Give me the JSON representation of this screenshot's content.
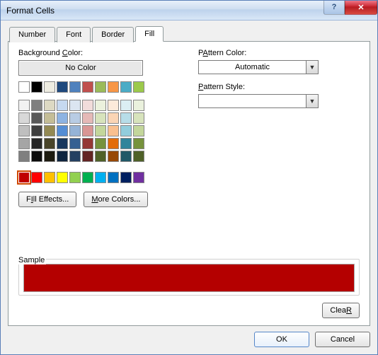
{
  "window": {
    "title": "Format Cells",
    "help_icon": "?",
    "close_icon": "✕"
  },
  "tabs": [
    {
      "label": "Number",
      "active": false
    },
    {
      "label": "Font",
      "active": false
    },
    {
      "label": "Border",
      "active": false
    },
    {
      "label": "Fill",
      "active": true
    }
  ],
  "fill": {
    "bg_color_label_pre": "Background ",
    "bg_color_label_u": "C",
    "bg_color_label_post": "olor:",
    "no_color_label": "No Color",
    "fill_effects_label": "Fill Effects...",
    "fill_effects_u": "I",
    "more_colors_label": "More Colors...",
    "more_colors_u": "M",
    "pattern_color_label": "Pattern Color:",
    "pattern_color_u": "A",
    "pattern_color_value": "Automatic",
    "pattern_style_label": "Pattern Style:",
    "pattern_style_u": "P",
    "pattern_style_value": "",
    "theme_colors_row1": [
      "#ffffff",
      "#000000",
      "#eeece1",
      "#1f497d",
      "#4f81bd",
      "#c0504d",
      "#9bbb59",
      "#f79646",
      "#4bacc6",
      "#9cc94b"
    ],
    "theme_colors_rows": [
      [
        "#f2f2f2",
        "#7f7f7f",
        "#ddd9c3",
        "#c6d9f0",
        "#dbe5f1",
        "#f2dcdb",
        "#ebf1dd",
        "#fdeada",
        "#dbeef3",
        "#eaf1dd"
      ],
      [
        "#d8d8d8",
        "#595959",
        "#c4bd97",
        "#8db3e2",
        "#b8cce4",
        "#e5b9b7",
        "#d7e3bc",
        "#fbd5b5",
        "#b7dde8",
        "#d7e3bc"
      ],
      [
        "#bfbfbf",
        "#3f3f3f",
        "#938953",
        "#548dd4",
        "#95b3d7",
        "#d99694",
        "#c3d69b",
        "#fac08f",
        "#92cddc",
        "#c3d69b"
      ],
      [
        "#a5a5a5",
        "#262626",
        "#494429",
        "#17365d",
        "#366092",
        "#953734",
        "#76923c",
        "#e36c09",
        "#31859b",
        "#76923c"
      ],
      [
        "#7f7f7f",
        "#0c0c0c",
        "#1d1b10",
        "#0f243e",
        "#244061",
        "#632423",
        "#4f6128",
        "#974806",
        "#205867",
        "#4f6128"
      ]
    ],
    "standard_colors": [
      "#c00000",
      "#ff0000",
      "#ffc000",
      "#ffff00",
      "#92d050",
      "#00b050",
      "#00b0f0",
      "#0070c0",
      "#002060",
      "#7030a0"
    ],
    "selected_color": "#c00000"
  },
  "sample": {
    "label": "Sample",
    "color": "#b40000"
  },
  "buttons": {
    "clear": "Clear",
    "clear_u": "R",
    "ok": "OK",
    "cancel": "Cancel"
  }
}
